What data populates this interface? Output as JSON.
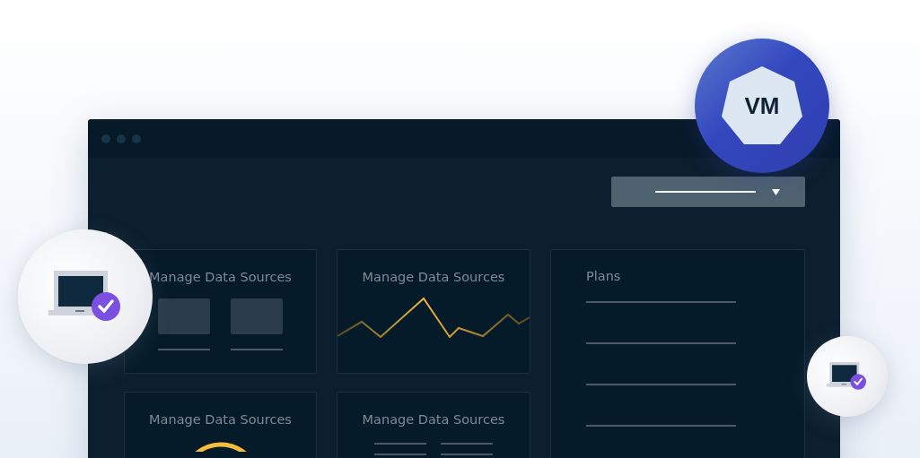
{
  "window": {
    "dropdown": {
      "expanded": false
    }
  },
  "cards": [
    {
      "kind": "tiles",
      "title": "Manage Data Sources"
    },
    {
      "kind": "line-chart",
      "title": "Manage Data Sources"
    },
    {
      "kind": "gauge",
      "title": "Manage Data Sources"
    },
    {
      "kind": "lines",
      "title": "Manage Data Sources"
    }
  ],
  "plans": {
    "title": "Plans"
  },
  "vm_badge": {
    "label": "VM"
  },
  "devices": [
    {
      "checked": true
    },
    {
      "checked": true
    }
  ]
}
